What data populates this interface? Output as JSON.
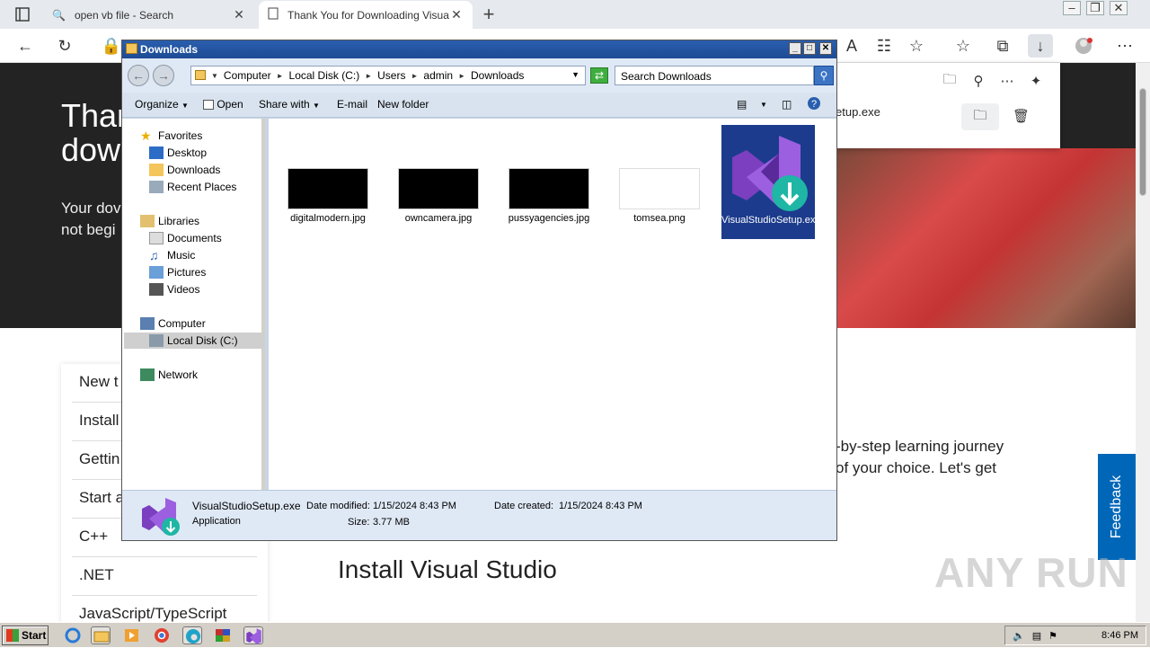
{
  "browser": {
    "tabs": [
      {
        "title": "open vb file - Search"
      },
      {
        "title": "Thank You for Downloading Visual Studio"
      }
    ],
    "download_panel": {
      "file_name": "etup.exe"
    }
  },
  "page": {
    "hero_title_line1": "Than",
    "hero_title_line2": "dow",
    "hero_sub_line1": "Your dov",
    "hero_sub_line2": "not begi",
    "nav_items": [
      "New t",
      "Install",
      "Gettin",
      "Start a",
      "C++",
      ".NET",
      "JavaScript/TypeScript"
    ],
    "body_line1": "-by-step learning journey",
    "body_line2": "of your choice. Let's get",
    "install_heading": "Install Visual Studio",
    "feedback": "Feedback",
    "watermark": "ANY RUN"
  },
  "explorer": {
    "title": "Downloads",
    "breadcrumb": [
      "Computer",
      "Local Disk (C:)",
      "Users",
      "admin",
      "Downloads"
    ],
    "search_placeholder": "Search Downloads",
    "commands": {
      "organize": "Organize",
      "open": "Open",
      "share_with": "Share with",
      "email": "E-mail",
      "new_folder": "New folder"
    },
    "nav": {
      "favorites": "Favorites",
      "desktop": "Desktop",
      "downloads": "Downloads",
      "recent": "Recent Places",
      "libraries": "Libraries",
      "documents": "Documents",
      "music": "Music",
      "pictures": "Pictures",
      "videos": "Videos",
      "computer": "Computer",
      "local_disk": "Local Disk (C:)",
      "network": "Network"
    },
    "files": [
      {
        "name": "digitalmodern.jpg"
      },
      {
        "name": "owncamera.jpg"
      },
      {
        "name": "pussyagencies.jpg"
      },
      {
        "name": "tomsea.png"
      },
      {
        "name": "VisualStudioSetup.exe"
      }
    ],
    "details": {
      "name": "VisualStudioSetup.exe",
      "type": "Application",
      "date_modified_label": "Date modified:",
      "date_modified": "1/15/2024 8:43 PM",
      "size_label": "Size:",
      "size": "3.77 MB",
      "date_created_label": "Date created:",
      "date_created": "1/15/2024 8:43 PM"
    }
  },
  "taskbar": {
    "start": "Start",
    "clock": "8:46 PM"
  },
  "colors": {
    "vs_purple": "#7b3fbf",
    "vs_teal": "#1fb6a5",
    "selection": "#1c3b8c",
    "feedback": "#0067b8"
  }
}
